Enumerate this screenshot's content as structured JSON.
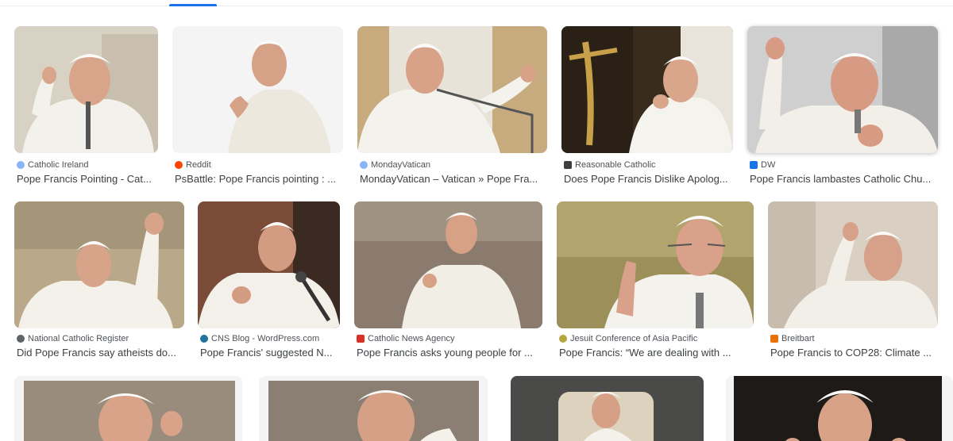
{
  "results": [
    {
      "source": "Catholic Ireland",
      "caption": "Pope Francis Pointing - Cat...",
      "icon": "globe-icon",
      "color": "#8ab4f8"
    },
    {
      "source": "Reddit",
      "caption": "PsBattle: Pope Francis pointing : ...",
      "icon": "reddit-icon",
      "color": "#ff4500"
    },
    {
      "source": "MondayVatican",
      "caption": "MondayVatican – Vatican » Pope Fra...",
      "icon": "globe-icon",
      "color": "#8ab4f8"
    },
    {
      "source": "Reasonable Catholic",
      "caption": "Does Pope Francis Dislike Apolog...",
      "icon": "site-icon",
      "color": "#3c4043"
    },
    {
      "source": "DW",
      "caption": "Pope Francis lambastes Catholic Chu...",
      "icon": "dw-icon",
      "color": "#1a73e8"
    },
    {
      "source": "National Catholic Register",
      "caption": "Did Pope Francis say atheists do...",
      "icon": "star-icon",
      "color": "#5f6368"
    },
    {
      "source": "CNS Blog - WordPress.com",
      "caption": "Pope Francis' suggested N...",
      "icon": "wordpress-icon",
      "color": "#21759b"
    },
    {
      "source": "Catholic News Agency",
      "caption": "Pope Francis asks young people for ...",
      "icon": "cna-icon",
      "color": "#d93025"
    },
    {
      "source": "Jesuit Conference of Asia Pacific",
      "caption": "Pope Francis: “We are dealing with ...",
      "icon": "leaf-icon",
      "color": "#b5a642"
    },
    {
      "source": "Breitbart",
      "caption": "Pope Francis to COP28: Climate ...",
      "icon": "breitbart-icon",
      "color": "#e8710a"
    }
  ]
}
